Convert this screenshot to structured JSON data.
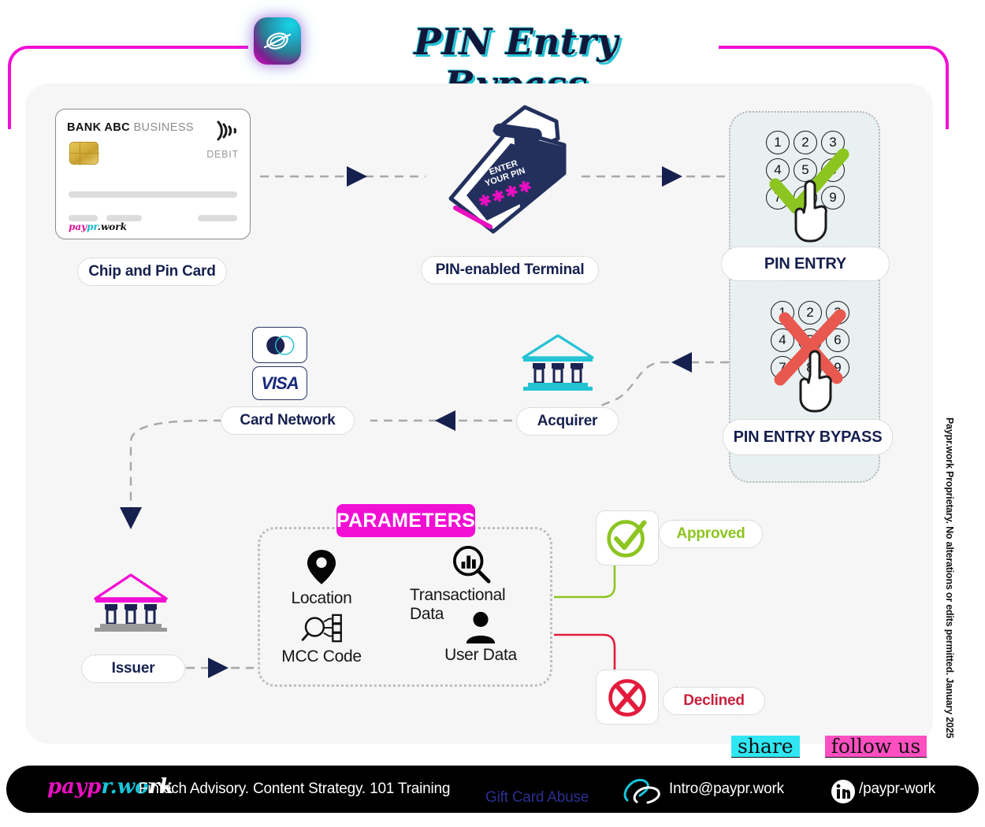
{
  "header": {
    "title": "PIN Entry Bypass",
    "logo_icon": "paypr-work-swirl-icon"
  },
  "card": {
    "bank_bold": "BANK ABC",
    "bank_light": "BUSINESS",
    "type": "DEBIT",
    "brand": "paypr.work",
    "contactless_icon": "contactless-wave-icon",
    "chip_icon": "emv-chip-icon",
    "label": "Chip and Pin Card"
  },
  "terminal": {
    "screen_line1": "ENTER",
    "screen_line2": "YOUR PIN",
    "pin_mask": "✱✱✱✱",
    "label": "PIN-enabled Terminal"
  },
  "pin_entry": {
    "label": "PIN ENTRY",
    "keys": [
      "1",
      "2",
      "3",
      "4",
      "5",
      "6",
      "7",
      "8",
      "9"
    ],
    "mark_icon": "green-check-icon",
    "hand_icon": "pointing-hand-icon",
    "mark_color": "#8CC520"
  },
  "pin_bypass": {
    "label": "PIN ENTRY BYPASS",
    "keys": [
      "1",
      "2",
      "3",
      "4",
      "5",
      "6",
      "7",
      "8",
      "9"
    ],
    "mark_icon": "red-cross-icon",
    "hand_icon": "pointing-hand-icon",
    "mark_color": "#E8584F"
  },
  "card_network": {
    "label": "Card Network",
    "logos": [
      "mastercard-circles-icon",
      "visa-wordmark-icon"
    ],
    "visa_text": "VISA"
  },
  "acquirer": {
    "label": "Acquirer",
    "icon": "bank-building-icon"
  },
  "issuer": {
    "label": "Issuer",
    "icon": "bank-building-icon"
  },
  "parameters": {
    "title": "PARAMETERS",
    "items": [
      {
        "label": "Location",
        "icon": "map-pin-icon"
      },
      {
        "label": "Transactional Data",
        "icon": "chart-magnifier-icon"
      },
      {
        "label": "MCC Code",
        "icon": "magnifier-categories-icon"
      },
      {
        "label": "User Data",
        "icon": "user-person-icon"
      }
    ]
  },
  "outcomes": [
    {
      "label": "Approved",
      "icon": "circle-check-icon",
      "color": "#8CC520"
    },
    {
      "label": "Declined",
      "icon": "circle-cross-icon",
      "color": "#E31B3D"
    }
  ],
  "social": {
    "share_label": "share",
    "follow_label": "follow us",
    "share_highlight": "#2FE6F2",
    "follow_highlight": "#FF4FC1"
  },
  "copyright": "Paypr.work Proprietary. No alterations or edits permitted. January 2025",
  "footer": {
    "logo": "paypr.work",
    "tagline": "Fintech Advisory. Content Strategy. 101 Training",
    "middle_link": "Gift Card Abuse",
    "email": "Intro@paypr.work",
    "linkedin": "/paypr-work",
    "clip_icon": "paperclip-icon",
    "linkedin_icon": "linkedin-icon"
  },
  "colors": {
    "magenta": "#f20fd4",
    "navy": "#16204f",
    "teal": "#23c3d4",
    "panel": "#f6f6f6"
  }
}
